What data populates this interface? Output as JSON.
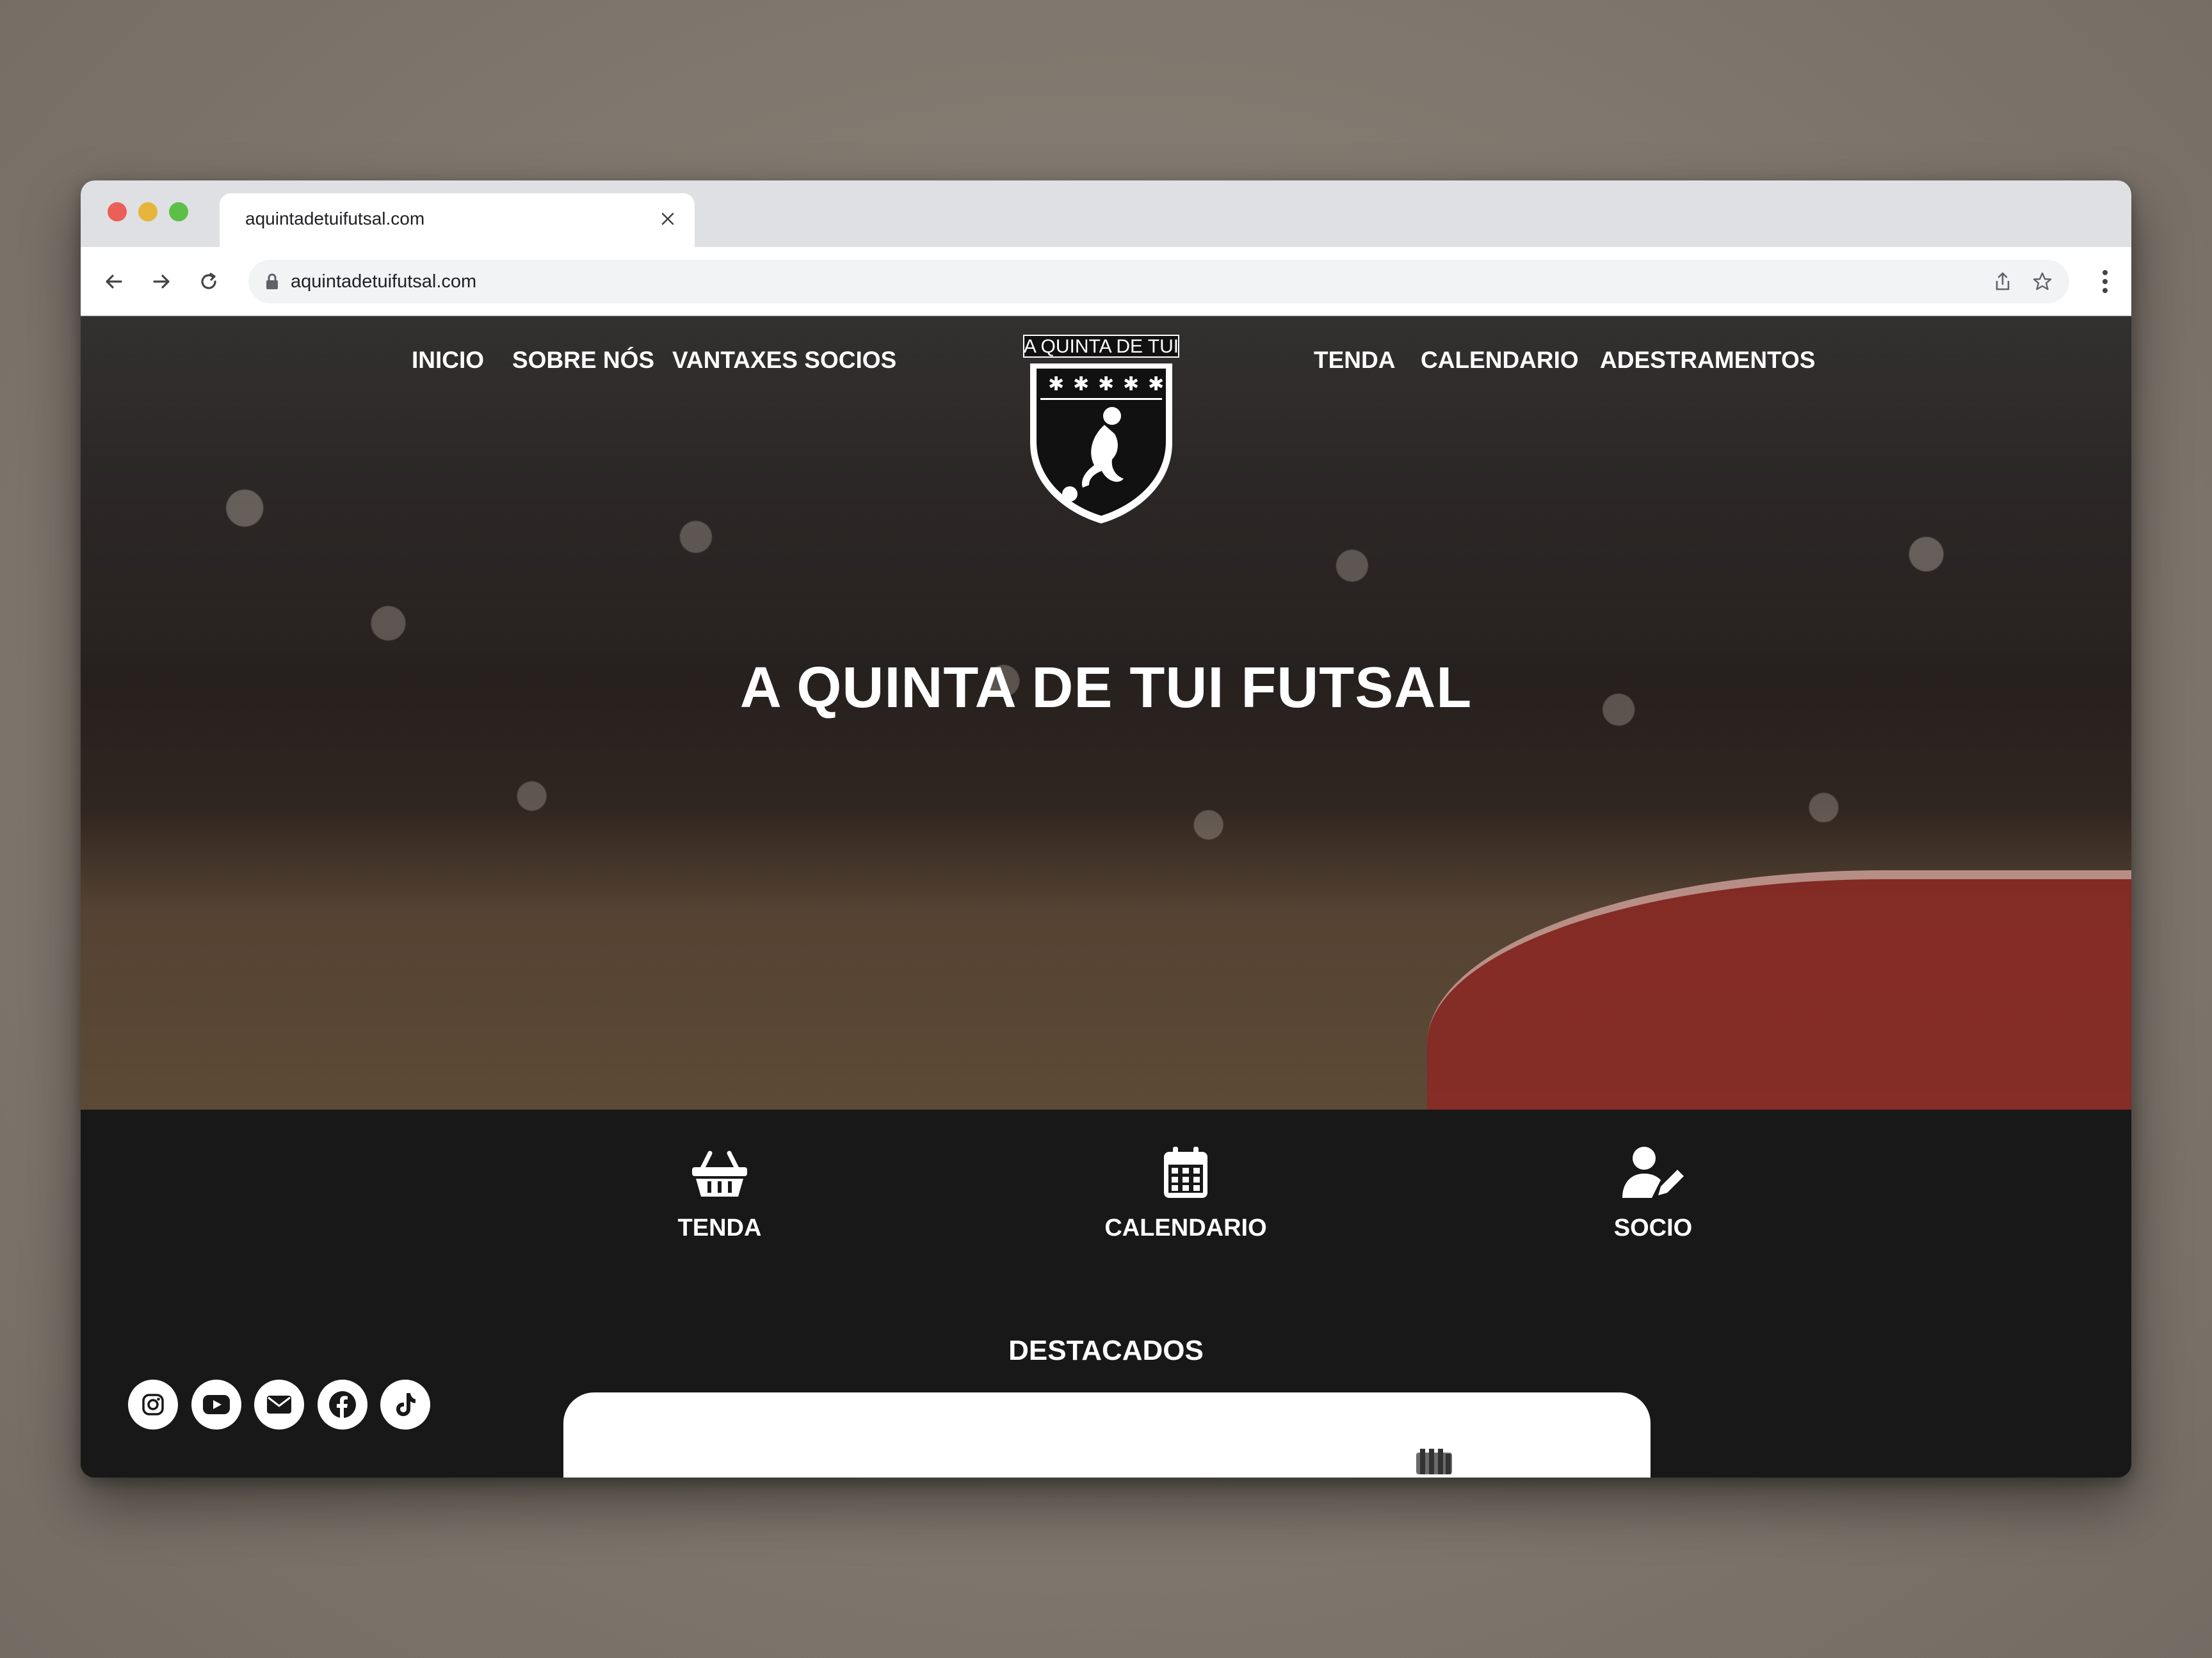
{
  "browser": {
    "tab_title": "aquintadetuifutsal.com",
    "url": "aquintadetuifutsal.com"
  },
  "nav": {
    "left": [
      "INICIO",
      "SOBRE NÓS",
      "VANTAXES SOCIOS"
    ],
    "right": [
      "TENDA",
      "CALENDARIO",
      "ADESTRAMENTOS"
    ]
  },
  "logo": {
    "text": "A QUINTA DE TUI"
  },
  "hero": {
    "title": "A QUINTA DE TUI FUTSAL"
  },
  "features": [
    {
      "label": "TENDA",
      "icon": "basket-icon"
    },
    {
      "label": "CALENDARIO",
      "icon": "calendar-icon"
    },
    {
      "label": "SOCIO",
      "icon": "user-edit-icon"
    }
  ],
  "featured": {
    "title": "DESTACADOS"
  },
  "social": [
    "instagram-icon",
    "youtube-icon",
    "email-icon",
    "facebook-icon",
    "tiktok-icon"
  ],
  "colors": {
    "background": "#181818",
    "text": "#ffffff",
    "court_red": "#8c2823"
  }
}
